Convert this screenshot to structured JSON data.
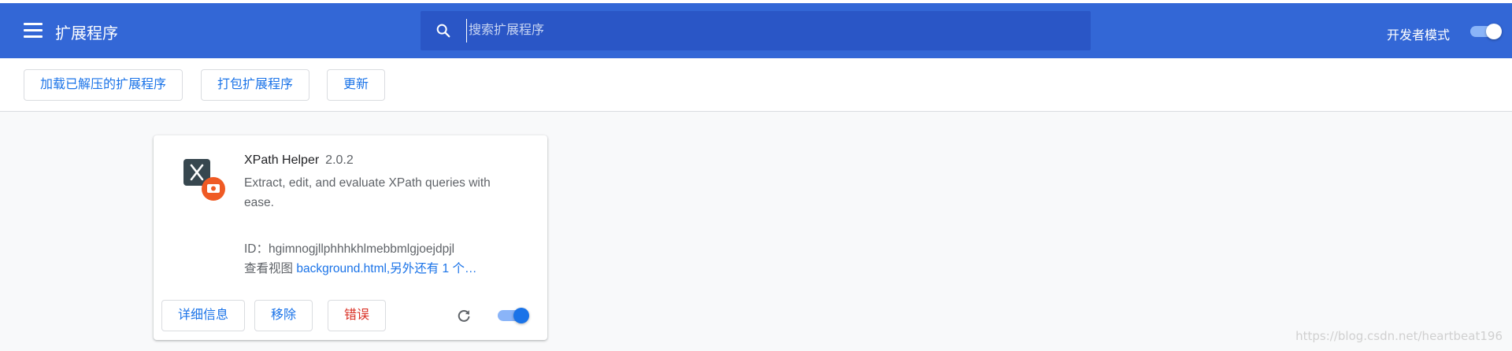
{
  "header": {
    "title": "扩展程序",
    "search_placeholder": "搜索扩展程序",
    "developer_mode_label": "开发者模式",
    "developer_mode_on": true,
    "background_color": "#3367d6"
  },
  "toolbar": {
    "load_unpacked": "加载已解压的扩展程序",
    "pack_extension": "打包扩展程序",
    "update": "更新"
  },
  "extension": {
    "name": "XPath Helper",
    "version": "2.0.2",
    "description": "Extract, edit, and evaluate XPath queries with ease.",
    "id_label": "ID：",
    "id": "hgimnogjllphhhkhlmebbmlgjoejdpjl",
    "views_label": "查看视图",
    "views_link": "background.html,另外还有 1 个…",
    "details_button": "详细信息",
    "remove_button": "移除",
    "errors_button": "错误",
    "enabled": true
  },
  "watermark": "https://blog.csdn.net/heartbeat196"
}
